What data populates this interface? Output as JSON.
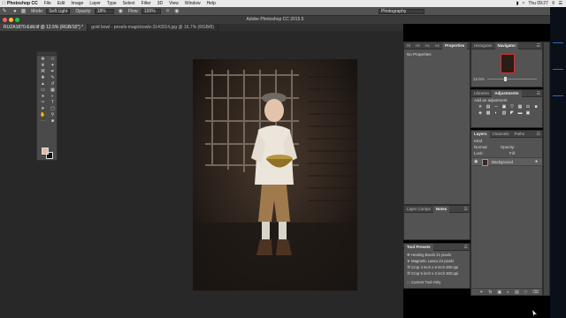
{
  "menubar": {
    "app_name": "Photoshop CC",
    "items": [
      "File",
      "Edit",
      "Image",
      "Layer",
      "Type",
      "Select",
      "Filter",
      "3D",
      "View",
      "Window",
      "Help"
    ],
    "clock": "Thu 09:27",
    "right_icons": [
      "battery-icon",
      "wifi-icon",
      "search-icon",
      "menu-icon"
    ]
  },
  "options_bar": {
    "mode_label": "Mode:",
    "mode_value": "Soft Light",
    "opacity_label": "Opacity:",
    "opacity_value": "18%",
    "flow_label": "Flow:",
    "flow_value": "100%",
    "workspace": "Photography"
  },
  "window": {
    "title": "Adobe Photoshop CC 2015.5"
  },
  "document_tabs": [
    {
      "label": "RUZA1870-Edit.tif @ 12.5% (RGB/16*) *",
      "active": true
    },
    {
      "label": "gold bowl - pexels-magicbowls-3143014.jpg @ 16.7% (RGB/8)",
      "active": false
    }
  ],
  "properties_panel": {
    "tabs": [
      "Hi",
      "Hi",
      "Ac",
      "Ac",
      "Properties",
      "Hi",
      "Ac"
    ],
    "active_tab": "Properties",
    "content": "No Properties"
  },
  "navigator_panel": {
    "tabs": [
      "Histogram",
      "Navigator"
    ],
    "active_tab": "Navigator",
    "zoom": "12.5%"
  },
  "adjustments_panel": {
    "tabs": [
      "Libraries",
      "Adjustments"
    ],
    "active_tab": "Adjustments",
    "label": "Add an adjustment"
  },
  "layers_panel": {
    "tabs": [
      "Layers",
      "Channels",
      "Paths"
    ],
    "active_tab": "Layers",
    "kind_label": "Kind",
    "blend_mode": "Normal",
    "opacity_label": "Opacity:",
    "fill_label": "Fill:",
    "lock_label": "Lock:",
    "layers": [
      {
        "name": "Background",
        "visible": true,
        "locked": true
      }
    ]
  },
  "layer_comps_panel": {
    "tabs": [
      "Layer Comps",
      "Notes"
    ],
    "active_tab": "Notes"
  },
  "tool_presets_panel": {
    "tab": "Tool Presets",
    "items": [
      "Healing Brush 21 pixels",
      "Magnetic Lasso 24 pixels",
      "Crop 4 inch x 6 inch 300 ppi",
      "Crop 5 inch x 3 inch 300 ppi"
    ],
    "current_only_label": "Current Tool Only"
  },
  "colors": {
    "foreground": "#e8b9a6",
    "background": "#111111",
    "panel_bg": "#535353",
    "canvas_bg": "#282828"
  },
  "toolbox_icons": [
    "move-icon",
    "marquee-icon",
    "lasso-icon",
    "quick-select-icon",
    "crop-icon",
    "eyedropper-icon",
    "healing-icon",
    "brush-icon",
    "clone-stamp-icon",
    "history-brush-icon",
    "eraser-icon",
    "gradient-icon",
    "blur-icon",
    "dodge-icon",
    "pen-icon",
    "type-icon",
    "path-select-icon",
    "shape-icon",
    "hand-icon",
    "zoom-icon",
    "more-tools-icon",
    "default-colors-icon"
  ]
}
